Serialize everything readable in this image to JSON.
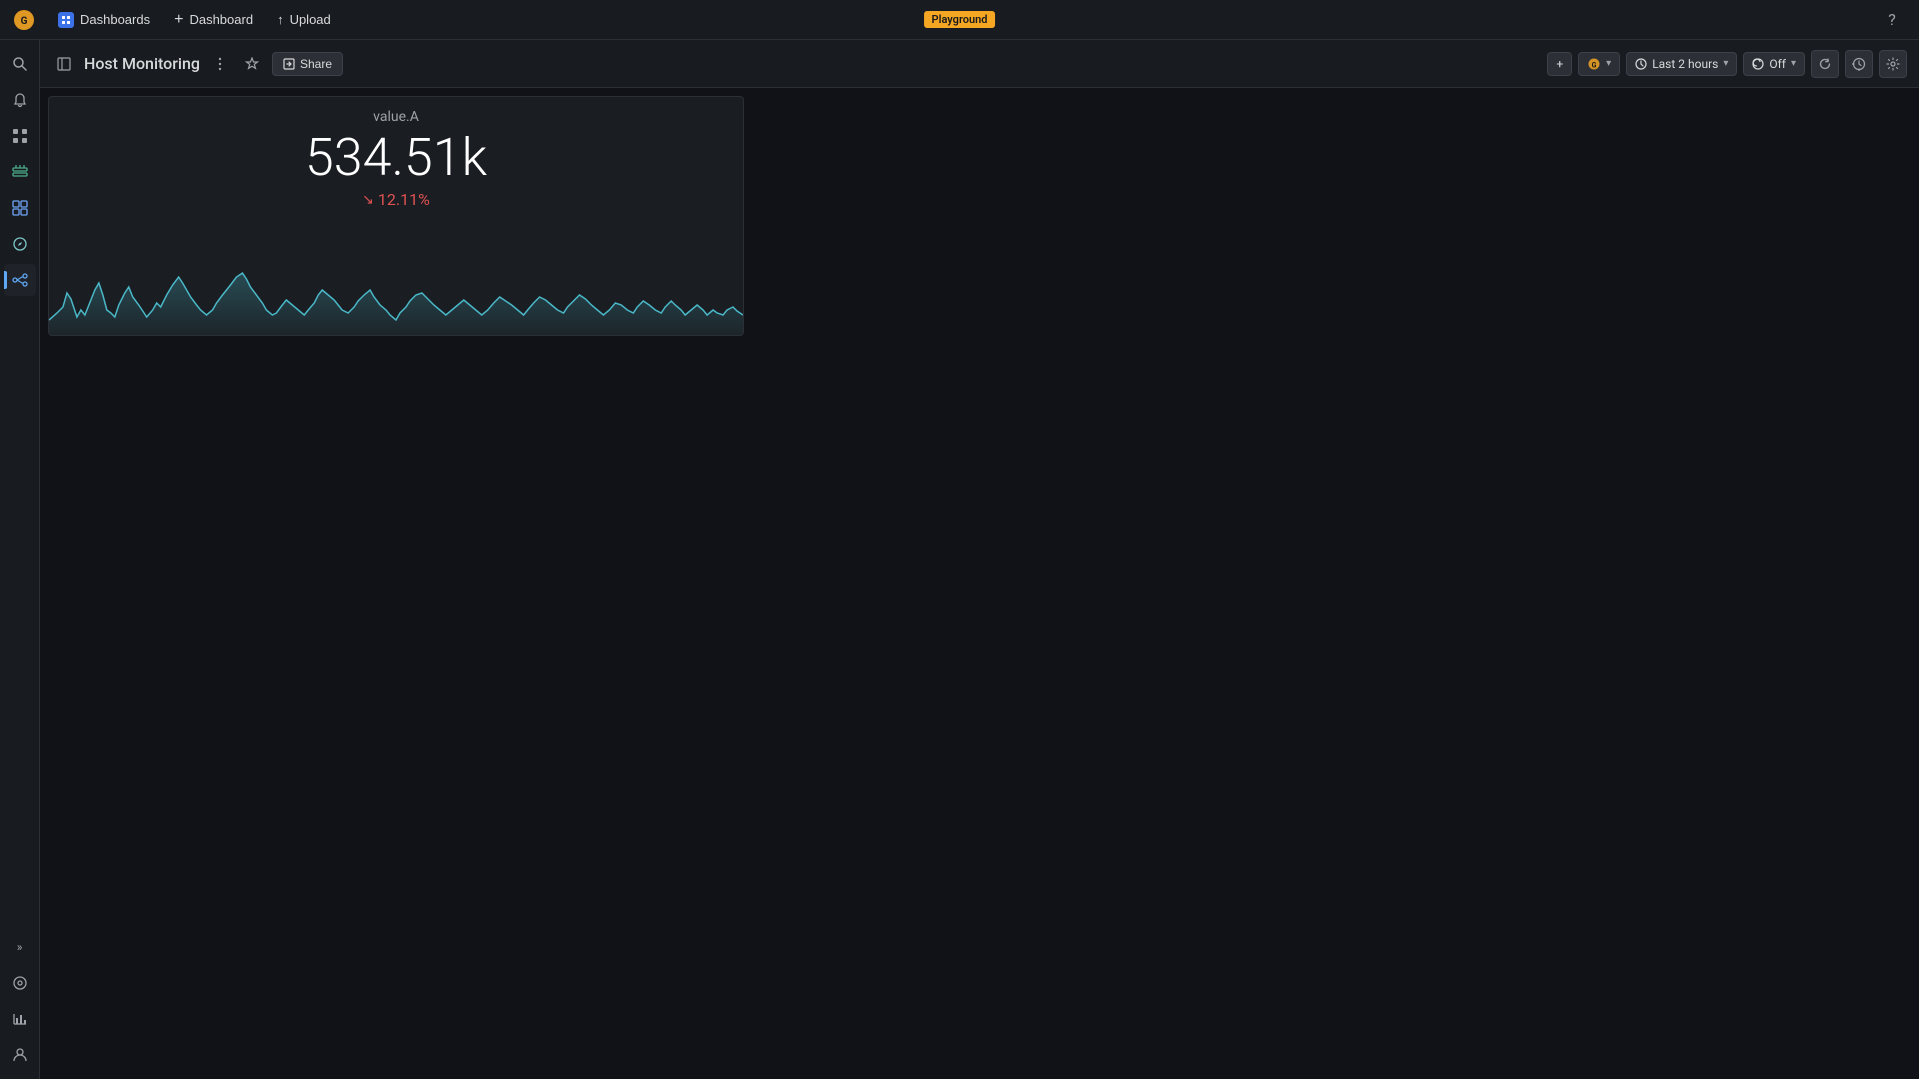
{
  "topbar": {
    "dashboards_label": "Dashboards",
    "dashboard_label": "Dashboard",
    "upload_label": "Upload",
    "playground_label": "Playground",
    "help_icon": "?"
  },
  "sidebar": {
    "items": [
      {
        "name": "search",
        "icon": "🔍",
        "active": false
      },
      {
        "name": "alerts",
        "icon": "🔔",
        "active": false
      },
      {
        "name": "apps-grid",
        "icon": "⊞",
        "active": false
      },
      {
        "name": "stacks",
        "icon": "▦",
        "active": false
      },
      {
        "name": "dashboards",
        "icon": "▣",
        "active": false
      },
      {
        "name": "explore",
        "icon": "🧭",
        "active": false
      },
      {
        "name": "connections",
        "icon": "◎",
        "active": true
      }
    ],
    "bottom_items": [
      {
        "name": "expand",
        "icon": "»"
      },
      {
        "name": "settings-circle",
        "icon": "⚙"
      },
      {
        "name": "chart",
        "icon": "📊"
      },
      {
        "name": "user-circle",
        "icon": "👤"
      }
    ]
  },
  "dashboard": {
    "title": "Host Monitoring",
    "share_label": "Share",
    "add_label": "+",
    "time_range_label": "Last 2 hours",
    "auto_refresh_label": "Off",
    "panel": {
      "metric_label": "value.A",
      "metric_value": "534.51k",
      "metric_change": "12.11%",
      "change_direction": "down"
    }
  }
}
